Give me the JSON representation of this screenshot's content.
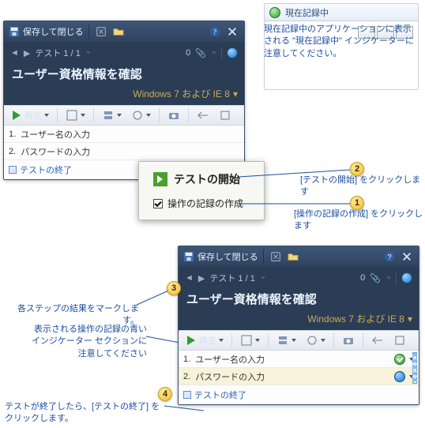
{
  "colors": {
    "accent": "#2b3c55",
    "env": "#c6ac54",
    "link": "#1a4ea0"
  },
  "windowA": {
    "saveClose": "保存して閉じる",
    "breadcrumb": "テスト 1 / 1",
    "counter": "0",
    "pageTitle": "ユーザー資格情報を確認",
    "env": "Windows 7 および IE 8",
    "playLabel": "再生",
    "steps": [
      {
        "n": "1.",
        "label": "ユーザー名の入力"
      },
      {
        "n": "2.",
        "label": "パスワードの入力"
      }
    ],
    "endLabel": "テストの終了"
  },
  "popup": {
    "title": "テストの開始",
    "checkbox": "操作の記録の作成"
  },
  "recording": {
    "title": "現在記録中",
    "note": "現在記録中のアプリケーションに表示される \"現在記録中\" インジケーターに注意してください。"
  },
  "windowB": {
    "saveClose": "保存して閉じる",
    "breadcrumb": "テスト 1 / 1",
    "counter": "0",
    "pageTitle": "ユーザー資格情報を確認",
    "env": "Windows 7 および IE 8",
    "playLabel": "再生",
    "steps": [
      {
        "n": "1.",
        "label": "ユーザー名の入力"
      },
      {
        "n": "2.",
        "label": "パスワードの入力"
      }
    ],
    "endLabel": "テストの終了"
  },
  "callouts": {
    "c1": "[操作の記録の作成] をクリックします",
    "c2": "[テストの開始] をクリックします",
    "c3": "各ステップの結果をマークします。",
    "c4_line1": "表示される操作の記録の青い",
    "c4_line2": "インジケーター セクションに",
    "c4_line3": "注意してください",
    "c5_line1": "テストが終了したら、[テストの終了] を",
    "c5_line2": "クリックします。"
  },
  "bubbles": {
    "b1": "1",
    "b2": "2",
    "b3": "3",
    "b4": "4"
  }
}
